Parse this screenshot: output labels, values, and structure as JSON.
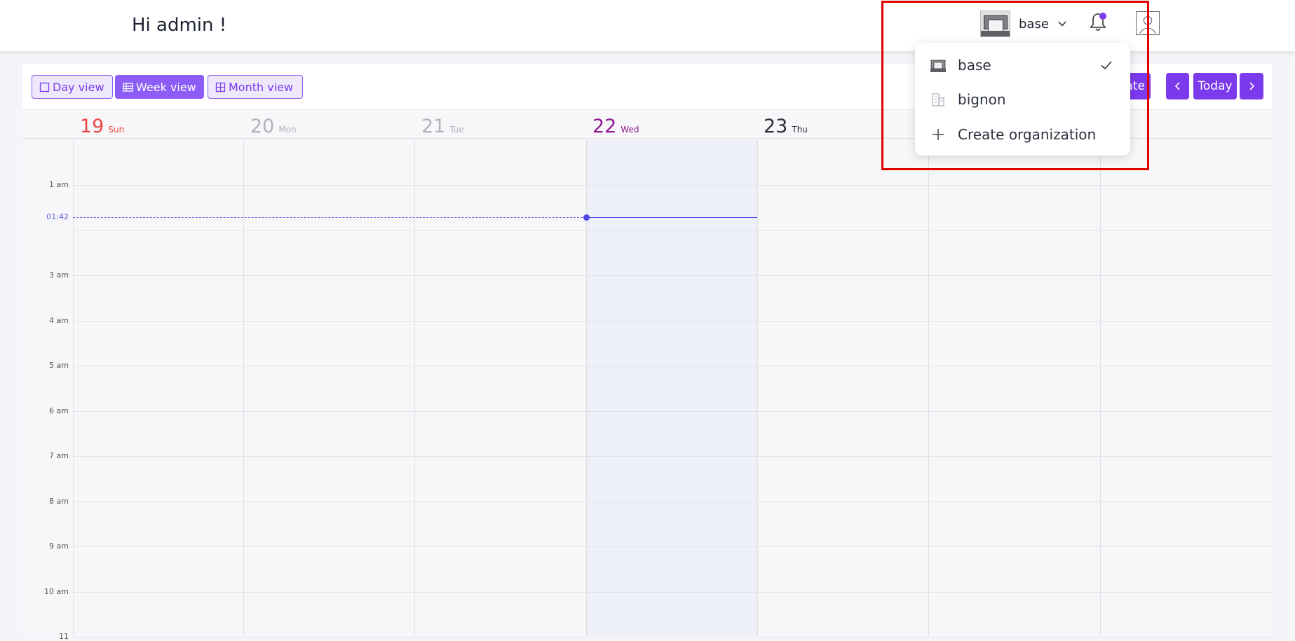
{
  "header": {
    "greeting": "Hi admin !",
    "org_selected": "base",
    "accent_color": "#7c3aed"
  },
  "toolbar": {
    "views": [
      {
        "label": "Day view",
        "style": "outline"
      },
      {
        "label": "Week view",
        "style": "filled"
      },
      {
        "label": "Month view",
        "style": "outline"
      }
    ],
    "create_label": "ate",
    "today_label": "Today",
    "prev_icon": "chevron-left-icon",
    "next_icon": "chevron-right-icon"
  },
  "week": {
    "days": [
      {
        "num": "19",
        "label": "Sun",
        "color": "#ef4444"
      },
      {
        "num": "20",
        "label": "Mon",
        "color": "#b0b3bb"
      },
      {
        "num": "21",
        "label": "Tue",
        "color": "#b0b3bb"
      },
      {
        "num": "22",
        "label": "Wed",
        "color": "#8e1b92"
      },
      {
        "num": "23",
        "label": "Thu",
        "color": "#2a2f3a"
      },
      {
        "num": "",
        "label": "",
        "color": "#2a2f3a"
      },
      {
        "num": "",
        "label": "Sat",
        "color": "#2a2f3a"
      }
    ],
    "hours": [
      "1 am",
      "",
      "3 am",
      "4 am",
      "5 am",
      "6 am",
      "7 am",
      "8 am",
      "9 am",
      "10 am",
      "11"
    ],
    "now_label": "01:42"
  },
  "org_dropdown": {
    "items": [
      {
        "label": "base",
        "icon": "org-thumbnail-icon",
        "selected": true
      },
      {
        "label": "bignon",
        "icon": "building-icon",
        "selected": false
      },
      {
        "label": "Create organization",
        "icon": "plus-icon",
        "selected": false
      }
    ]
  }
}
